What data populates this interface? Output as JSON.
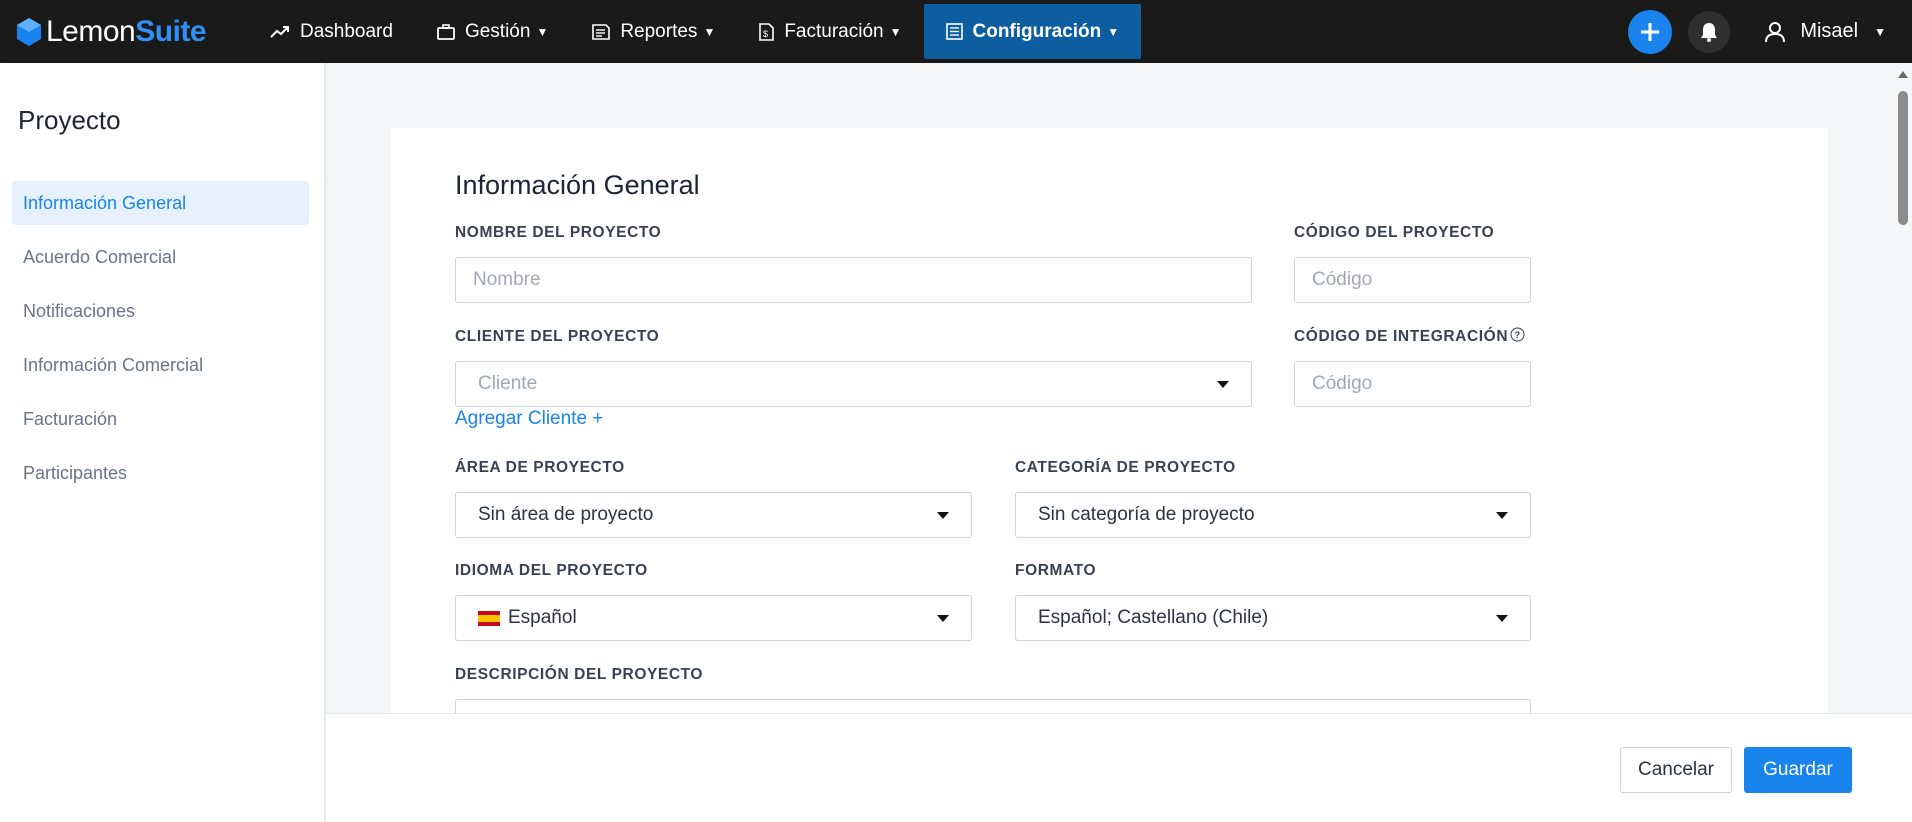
{
  "brand": {
    "name_part1": "Lemon",
    "name_part2": "Suite",
    "accent": "#1a84ee"
  },
  "nav": {
    "items": [
      {
        "label": "Dashboard",
        "icon": "trend-icon",
        "dropdown": false
      },
      {
        "label": "Gestión",
        "icon": "briefcase-icon",
        "dropdown": true
      },
      {
        "label": "Reportes",
        "icon": "report-icon",
        "dropdown": true
      },
      {
        "label": "Facturación",
        "icon": "invoice-icon",
        "dropdown": true
      },
      {
        "label": "Configuración",
        "icon": "settings-list-icon",
        "dropdown": true,
        "active": true
      }
    ],
    "user": "Misael"
  },
  "sidebar": {
    "title": "Proyecto",
    "items": [
      {
        "label": "Información General",
        "active": true
      },
      {
        "label": "Acuerdo Comercial"
      },
      {
        "label": "Notificaciones"
      },
      {
        "label": "Información Comercial"
      },
      {
        "label": "Facturación"
      },
      {
        "label": "Participantes"
      }
    ]
  },
  "form": {
    "title": "Información General",
    "project_name": {
      "label": "NOMBRE DEL PROYECTO",
      "placeholder": "Nombre"
    },
    "project_code": {
      "label": "CÓDIGO DEL PROYECTO",
      "placeholder": "Código"
    },
    "client": {
      "label": "CLIENTE DEL PROYECTO",
      "placeholder": "Cliente"
    },
    "integration_code": {
      "label": "CÓDIGO DE INTEGRACIÓN",
      "placeholder": "Código"
    },
    "add_client": "Agregar Cliente +",
    "area": {
      "label": "ÁREA DE PROYECTO",
      "value": "Sin área de proyecto"
    },
    "category": {
      "label": "CATEGORÍA DE PROYECTO",
      "value": "Sin categoría de proyecto"
    },
    "language": {
      "label": "IDIOMA DEL PROYECTO",
      "value": "Español"
    },
    "format": {
      "label": "FORMATO",
      "value": "Español; Castellano (Chile)"
    },
    "description": {
      "label": "DESCRIPCIÓN DEL PROYECTO"
    }
  },
  "footer": {
    "cancel": "Cancelar",
    "save": "Guardar"
  }
}
